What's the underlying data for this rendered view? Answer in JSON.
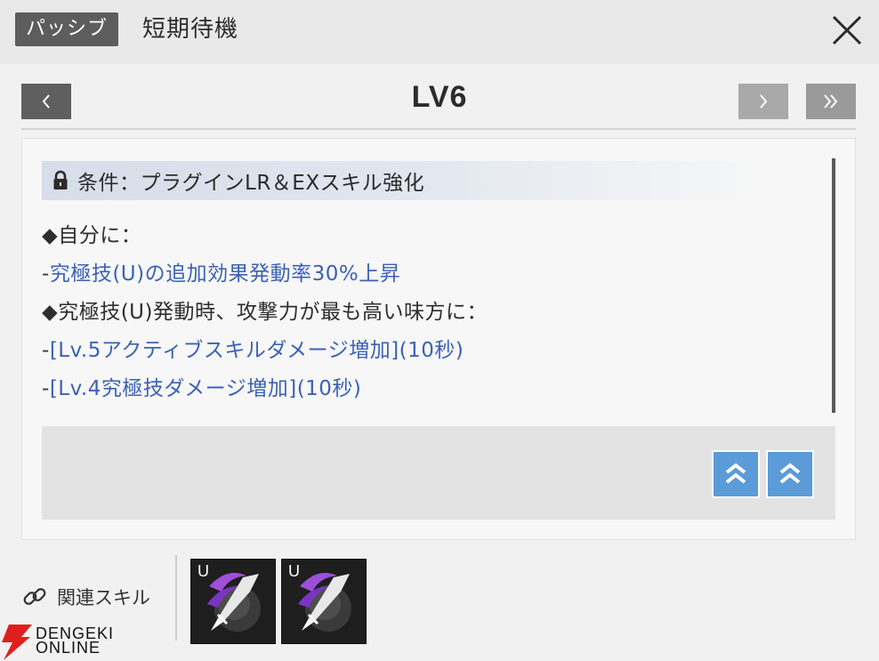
{
  "header": {
    "badge": "パッシブ",
    "title": "短期待機"
  },
  "level": {
    "label": "LV6"
  },
  "card": {
    "condition": "条件：プラグインLR＆EXスキル強化",
    "lines": [
      {
        "text": "◆自分に："
      },
      {
        "prefix": "-",
        "text": "究極技(U)の追加効果発動率30%上昇"
      },
      {
        "text": "◆究極技(U)発動時、攻撃力が最も高い味方に："
      },
      {
        "prefix": "-",
        "text": "[Lv.5アクティブスキルダメージ増加](10秒)"
      },
      {
        "prefix": "-",
        "text": "[Lv.4究極技ダメージ増加](10秒)"
      }
    ]
  },
  "related": {
    "label": "関連スキル",
    "skills": [
      {
        "badge": "U",
        "icon": "sword-slash-icon"
      },
      {
        "badge": "U",
        "icon": "sword-slash-icon"
      }
    ]
  },
  "watermark": {
    "line1": "DENGEKI",
    "line2": "ONLINE"
  },
  "colors": {
    "badge_bg": "#5d5d5d",
    "highlight_text": "#3c61b8",
    "upgrade_button": "#5b9bd8"
  },
  "icons": {
    "close": "close-icon",
    "prev": "chevron-left-icon",
    "next": "chevron-right-icon",
    "last": "double-chevron-right-icon",
    "lock": "lock-icon",
    "upgrade": "double-chevron-up-icon",
    "link": "link-icon"
  }
}
